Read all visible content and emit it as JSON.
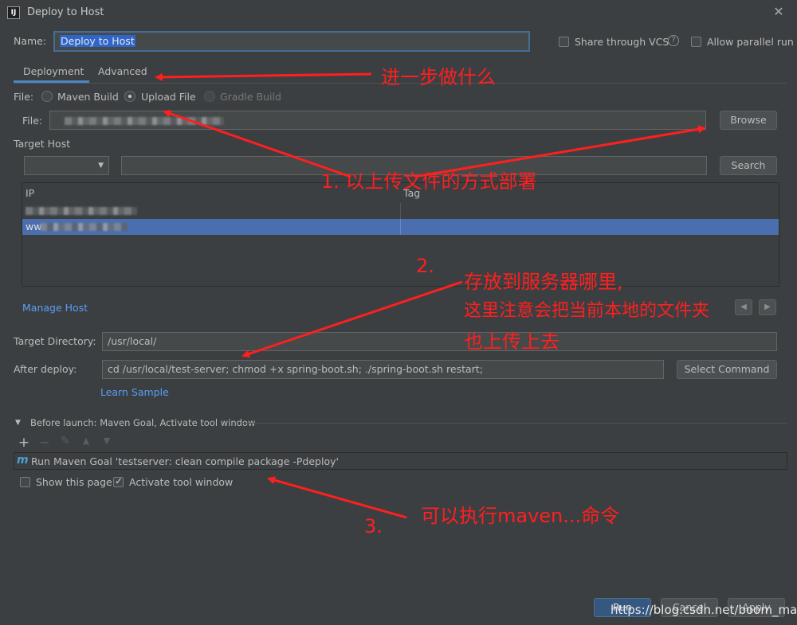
{
  "window": {
    "title": "Deploy to Host",
    "app_icon": "IJ"
  },
  "name_row": {
    "label": "Name:",
    "value": "Deploy to Host",
    "share_vcs": "Share through VCS",
    "allow_parallel": "Allow parallel run"
  },
  "tabs": [
    {
      "label": "Deployment",
      "active": true
    },
    {
      "label": "Advanced",
      "active": false
    }
  ],
  "file_type": {
    "label": "File:",
    "options": [
      {
        "label": "Maven Build",
        "selected": false
      },
      {
        "label": "Upload File",
        "selected": true
      },
      {
        "label": "Gradle Build",
        "selected": false,
        "disabled": true
      }
    ]
  },
  "file_row": {
    "label": "File:",
    "browse": "Browse"
  },
  "target_host": {
    "label": "Target Host",
    "search": "Search",
    "columns": [
      "IP",
      "Tag"
    ],
    "rows": [
      {
        "ip": "",
        "tag": "",
        "selected": false
      },
      {
        "ip": "ww",
        "tag": "",
        "selected": true
      }
    ],
    "manage_link": "Manage Host"
  },
  "target_directory": {
    "label": "Target Directory:",
    "value": "/usr/local/"
  },
  "after_deploy": {
    "label": "After deploy:",
    "value": "cd /usr/local/test-server; chmod +x spring-boot.sh; ./spring-boot.sh restart;",
    "select_command": "Select Command",
    "learn_link": "Learn Sample"
  },
  "before_launch": {
    "header": "Before launch: Maven Goal, Activate tool window",
    "task": "Run Maven Goal 'testserver: clean compile package -Pdeploy'",
    "show_page": "Show this page",
    "activate_tool": "Activate tool window"
  },
  "footer": {
    "run": "Run",
    "cancel": "Cancel",
    "apply": "Apply",
    "watermark": "https://blog.csdn.net/boom_man"
  },
  "annotations": {
    "tabs_note": "进一步做什么",
    "upload_note": "1. 以上传文件的方式部署",
    "dir_num": "2.",
    "dir_line1": "存放到服务器哪里,",
    "dir_line2": "这里注意会把当前本地的文件夹",
    "dir_line3": "也上传上去",
    "maven_num": "3.",
    "maven_note": "可以执行maven...命令"
  },
  "colors": {
    "background": "#3c3f41",
    "accent": "#4a88c7",
    "selection": "#4b6eaf",
    "link": "#589df6",
    "annotation": "#ff1f1f"
  }
}
